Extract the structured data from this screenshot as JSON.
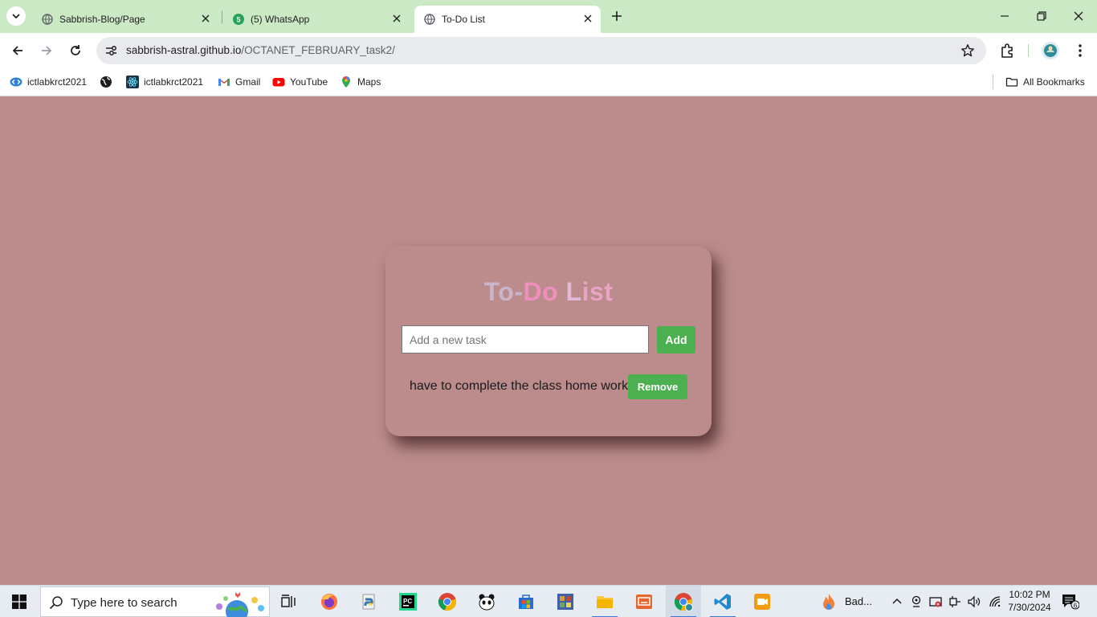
{
  "browser": {
    "tabs": [
      {
        "title": "Sabbrish-Blog/Page",
        "icon": "globe-icon"
      },
      {
        "title": "(5) WhatsApp",
        "icon": "whatsapp-icon",
        "badge": "5"
      },
      {
        "title": "To-Do List",
        "icon": "globe-icon"
      }
    ],
    "url_host": "sabbrish-astral.github.io",
    "url_path": "/OCTANET_FEBRUARY_task2/",
    "bookmarks": [
      {
        "label": "ictlabkrct2021",
        "icon": "code-icon"
      },
      {
        "label": "",
        "icon": "globe-icon"
      },
      {
        "label": "ictlabkrct2021",
        "icon": "react-icon"
      },
      {
        "label": "Gmail",
        "icon": "gmail-icon"
      },
      {
        "label": "YouTube",
        "icon": "youtube-icon"
      },
      {
        "label": "Maps",
        "icon": "maps-icon"
      }
    ],
    "all_bookmarks": "All Bookmarks"
  },
  "app": {
    "title_parts": [
      "To-",
      "Do",
      " L",
      "ist"
    ],
    "input_placeholder": "Add a new task",
    "add_label": "Add",
    "tasks": [
      {
        "text": "have to complete the class home work",
        "remove_label": "Remove"
      }
    ],
    "colors": {
      "background": "#bb8c8b",
      "button": "#4caf50"
    }
  },
  "taskbar": {
    "search_placeholder": "Type here to search",
    "running_app_label": "Bad...",
    "time": "10:02 PM",
    "date": "7/30/2024",
    "notifications": "6"
  }
}
